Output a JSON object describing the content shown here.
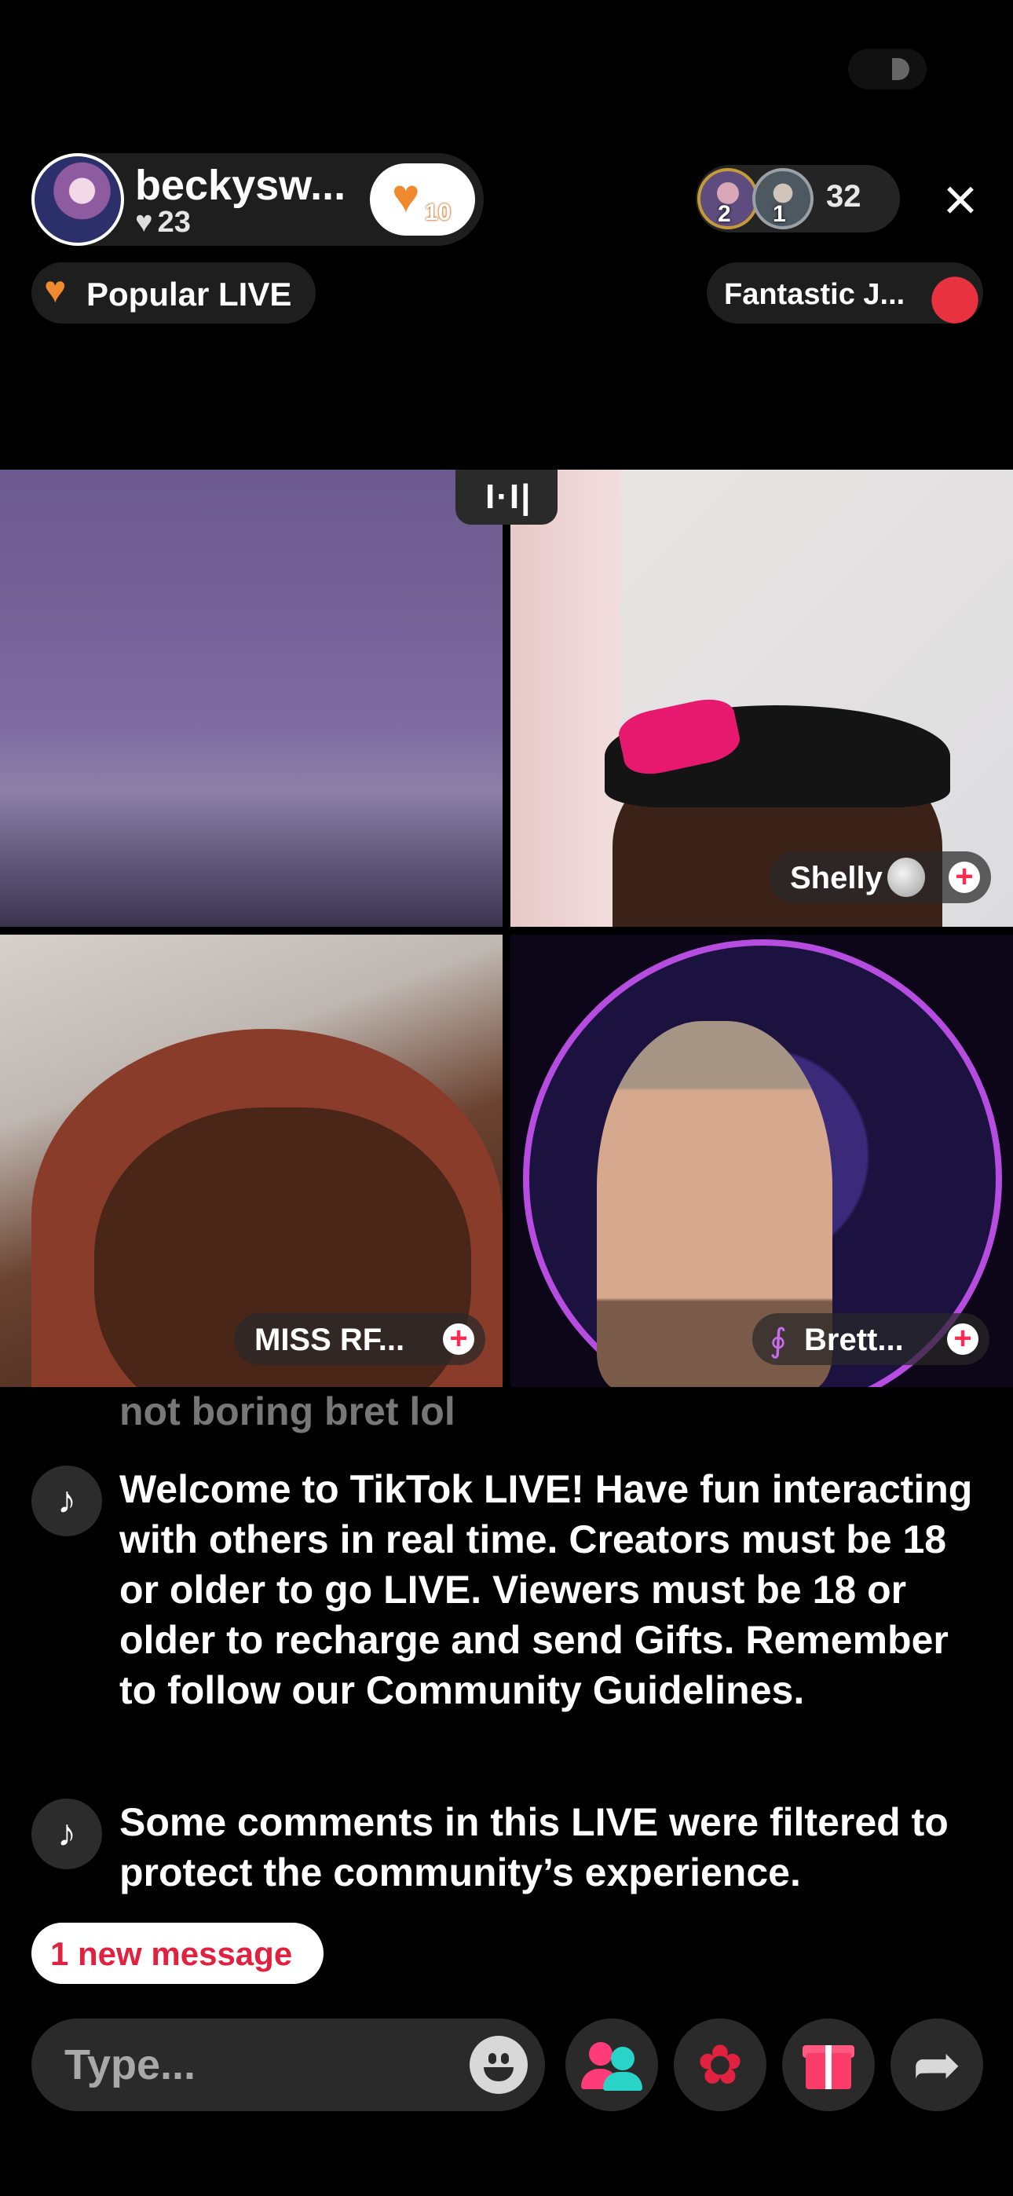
{
  "header": {
    "host_name": "beckysw...",
    "host_likes": "23",
    "follow_badge_count": "10",
    "viewer_badges": [
      "2",
      "1"
    ],
    "viewer_count": "32",
    "close_icon": "×"
  },
  "tags": {
    "popular": "Popular LIVE",
    "fantastic": "Fantastic J..."
  },
  "guests": [
    {
      "name": "Shelly"
    },
    {
      "name": "MISS RF..."
    },
    {
      "name": "Brett..."
    }
  ],
  "layout_icon": "I·I|",
  "chat": {
    "faded_message": "not boring bret lol",
    "messages": [
      {
        "icon": "tiktok-icon",
        "text": "Welcome to TikTok LIVE! Have fun interacting with others in real time. Creators must be 18 or older to go LIVE. Viewers must be 18 or older to recharge and send Gifts. Remember to follow our Community Guidelines."
      },
      {
        "icon": "tiktok-icon",
        "text": "Some comments in this LIVE were filtered to protect the community’s experience."
      }
    ],
    "new_message_label": "1 new message"
  },
  "composer": {
    "placeholder": "Type..."
  },
  "colors": {
    "accent_red": "#fe2c55",
    "popular_orange": "#f08a2e"
  }
}
